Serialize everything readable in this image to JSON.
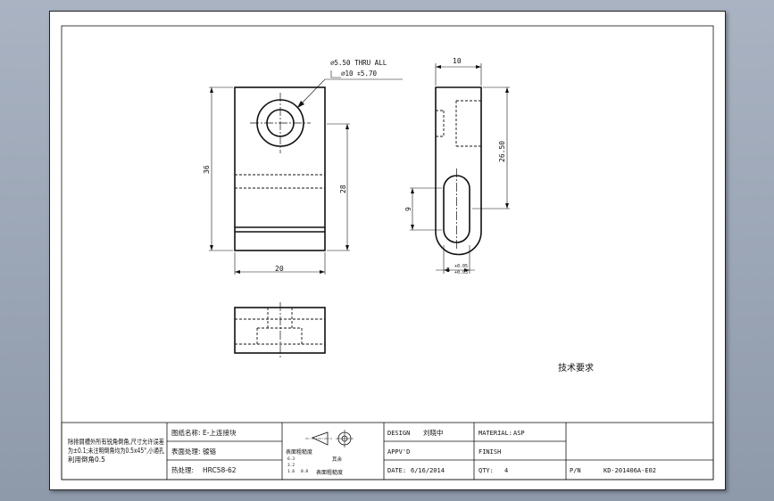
{
  "drawing": {
    "hole_callout_line1": "⌀5.50 THRU ALL",
    "hole_callout_line2": "⌀10 ⧧5.70",
    "dim_width_front": "20",
    "dim_height_total": "36",
    "dim_height_inner": "28",
    "dim_width_side": "10",
    "dim_side_height": "26.50",
    "dim_slot_height": "9",
    "dim_slot_width": "5",
    "dim_tol_upper": "+0.05",
    "dim_tol_lower": "+0.03"
  },
  "technical_requirements": "技术要求",
  "title_block": {
    "notes_line1": "除排屑槽外所有锐角倒角,尺寸允许误差",
    "notes_line2": "为±0.1;未注明倒角均为0.5x45°,小通孔",
    "notes_line3": "利用倒角0.5",
    "drawing_name_label": "图纸名称:",
    "drawing_name_value": "E-上连接块",
    "surface_treatment_label": "表面处理:",
    "surface_treatment_value": "镀铬",
    "heat_treatment_label": "热处理:",
    "heat_treatment_value": "HRC58-62",
    "roughness_title": "表面粗糙度",
    "roughness_values": [
      "6.3",
      "3.2",
      "1.6",
      "0.8"
    ],
    "roughness_other": "其余",
    "design_label": "DESIGN",
    "design_value": "刘晓中",
    "approved_label": "APPV'D",
    "date_label": "DATE:",
    "date_value": "6/16/2014",
    "material_label": "MATERIAL:",
    "material_value": "ASP",
    "finish_label": "FINISH",
    "qty_label": "QTY:",
    "qty_value": "4",
    "pn_label": "P/N",
    "pn_value": "KD-201406A-E02"
  }
}
